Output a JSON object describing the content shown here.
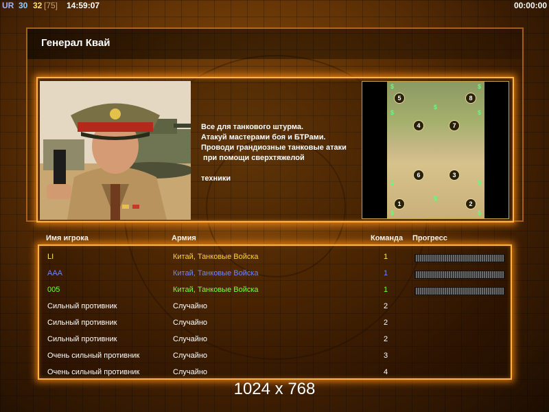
{
  "hud": {
    "ur_label": "UR",
    "value1": "30",
    "value2": "32",
    "value3": "[75]",
    "clock": "14:59:07",
    "timer": "00:00:00"
  },
  "general": {
    "name": "Генерал Квай",
    "description": [
      "Все для танкового штурма.",
      "Атакуй мастерами боя и БТРами.",
      "Проводи грандиозные танковые атаки",
      " при помощи сверхтяжелой",
      "",
      "техники"
    ]
  },
  "map": {
    "start_spots": [
      "5",
      "8",
      "4",
      "7",
      "6",
      "3",
      "1",
      "2"
    ],
    "resource_symbol": "$"
  },
  "table": {
    "headers": {
      "player": "Имя игрока",
      "army": "Армия",
      "team": "Команда",
      "progress": "Прогресс"
    },
    "rows": [
      {
        "player": "LI",
        "army": "Китай, Танковые Войска",
        "team": "1",
        "color": "#ffe45c",
        "army_color": "#ffd23a",
        "progress_visible": true
      },
      {
        "player": "AAA",
        "army": "Китай, Танковые Войска",
        "team": "1",
        "color": "#6e86ff",
        "army_color": "#6e86ff",
        "progress_visible": true
      },
      {
        "player": "005",
        "army": "Китай, Танковые Войска",
        "team": "1",
        "color": "#7cff3c",
        "army_color": "#7cff3c",
        "progress_visible": true
      },
      {
        "player": "Сильный противник",
        "army": "Случайно",
        "team": "2",
        "color": "#ffffff",
        "army_color": "#ffffff",
        "progress_visible": false
      },
      {
        "player": "Сильный противник",
        "army": "Случайно",
        "team": "2",
        "color": "#ffffff",
        "army_color": "#ffffff",
        "progress_visible": false
      },
      {
        "player": "Сильный противник",
        "army": "Случайно",
        "team": "2",
        "color": "#ffffff",
        "army_color": "#ffffff",
        "progress_visible": false
      },
      {
        "player": "Очень сильный противник",
        "army": "Случайно",
        "team": "3",
        "color": "#ffffff",
        "army_color": "#ffffff",
        "progress_visible": false
      },
      {
        "player": "Очень сильный противник",
        "army": "Случайно",
        "team": "4",
        "color": "#ffffff",
        "army_color": "#ffffff",
        "progress_visible": false
      }
    ]
  },
  "resolution": "1024 x 768"
}
